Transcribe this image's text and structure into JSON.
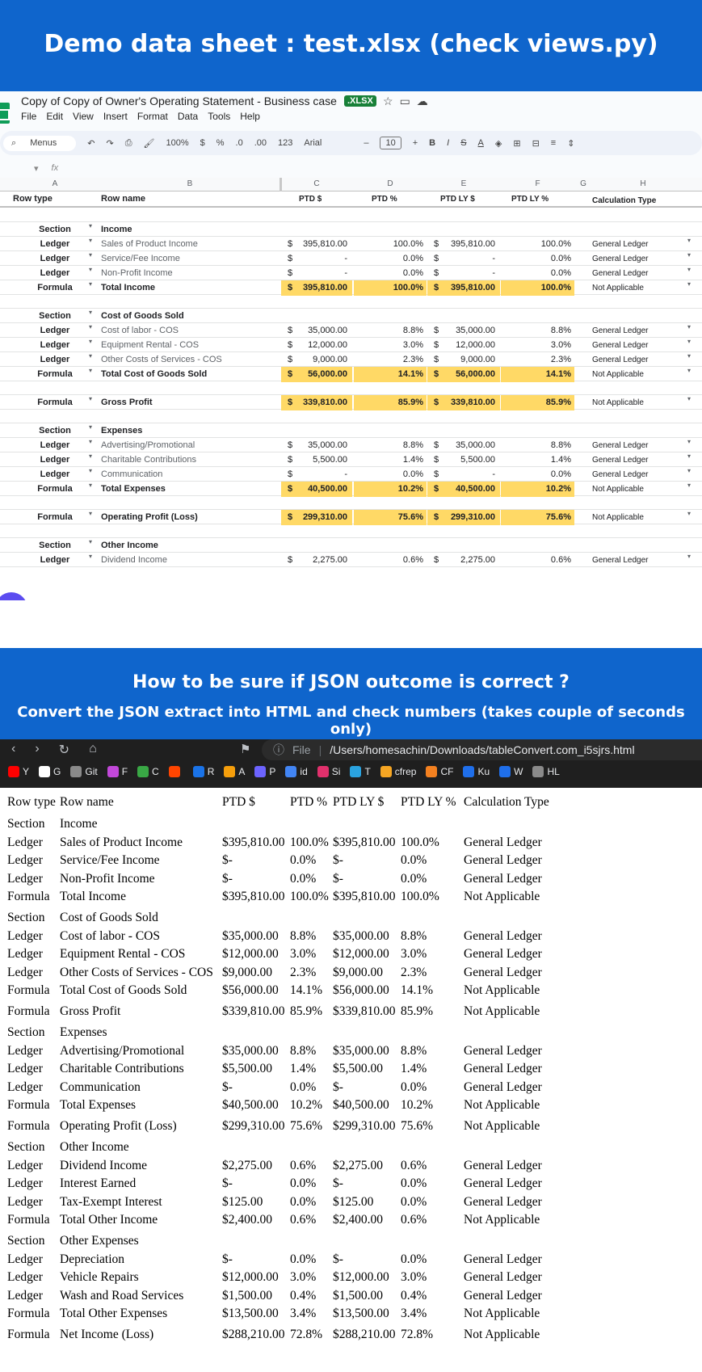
{
  "banner_top": "Demo data sheet :  test.xlsx (check views.py)",
  "banner_mid": {
    "title": "How to be sure if JSON outcome is correct ?",
    "subtitle": "Convert the JSON extract into HTML and check numbers (takes couple of seconds only)"
  },
  "sheets": {
    "doc_title": "Copy of Copy of Owner's Operating Statement - Business case",
    "badge": ".XLSX",
    "menu": [
      "File",
      "Edit",
      "View",
      "Insert",
      "Format",
      "Data",
      "Tools",
      "Help"
    ],
    "toolbar": {
      "menus": "Menus",
      "zoom": "100%",
      "currency": "$",
      "percent": "%",
      "dec_less": ".0",
      "dec_more": ".00",
      "fmt123": "123",
      "font": "Arial",
      "font_size": "10"
    },
    "fx": "fx",
    "col_letters": [
      "A",
      "B",
      "C",
      "D",
      "E",
      "F",
      "G",
      "H"
    ],
    "headers": {
      "row_type": "Row type",
      "row_name": "Row name",
      "ptd": "PTD $",
      "ptd_pct": "PTD %",
      "ptd_ly": "PTD LY $",
      "ptd_ly_pct": "PTD LY %",
      "calc": "Calculation Type"
    },
    "rows": [
      {
        "type": "",
        "name": "",
        "ptd": "",
        "ptd_pct": "",
        "ly": "",
        "ly_pct": "",
        "calc": "",
        "style": "blank"
      },
      {
        "type": "Section",
        "name": "Income",
        "ptd": "",
        "ptd_pct": "",
        "ly": "",
        "ly_pct": "",
        "calc": "",
        "style": "section"
      },
      {
        "type": "Ledger",
        "name": "Sales of Product Income",
        "ptd": "395,810.00",
        "ptd_pct": "100.0%",
        "ly": "395,810.00",
        "ly_pct": "100.0%",
        "calc": "General Ledger",
        "style": "ledger"
      },
      {
        "type": "Ledger",
        "name": "Service/Fee Income",
        "ptd": "-",
        "ptd_pct": "0.0%",
        "ly": "-",
        "ly_pct": "0.0%",
        "calc": "General Ledger",
        "style": "ledger"
      },
      {
        "type": "Ledger",
        "name": "Non-Profit Income",
        "ptd": "-",
        "ptd_pct": "0.0%",
        "ly": "-",
        "ly_pct": "0.0%",
        "calc": "General Ledger",
        "style": "ledger"
      },
      {
        "type": "Formula",
        "name": "Total Income",
        "ptd": "395,810.00",
        "ptd_pct": "100.0%",
        "ly": "395,810.00",
        "ly_pct": "100.0%",
        "calc": "Not Applicable",
        "style": "formula"
      },
      {
        "type": "",
        "name": "",
        "ptd": "",
        "ptd_pct": "",
        "ly": "",
        "ly_pct": "",
        "calc": "",
        "style": "blank"
      },
      {
        "type": "Section",
        "name": "Cost of Goods Sold",
        "ptd": "",
        "ptd_pct": "",
        "ly": "",
        "ly_pct": "",
        "calc": "",
        "style": "section"
      },
      {
        "type": "Ledger",
        "name": "Cost of labor - COS",
        "ptd": "35,000.00",
        "ptd_pct": "8.8%",
        "ly": "35,000.00",
        "ly_pct": "8.8%",
        "calc": "General Ledger",
        "style": "ledger"
      },
      {
        "type": "Ledger",
        "name": "Equipment Rental - COS",
        "ptd": "12,000.00",
        "ptd_pct": "3.0%",
        "ly": "12,000.00",
        "ly_pct": "3.0%",
        "calc": "General Ledger",
        "style": "ledger"
      },
      {
        "type": "Ledger",
        "name": "Other Costs of Services - COS",
        "ptd": "9,000.00",
        "ptd_pct": "2.3%",
        "ly": "9,000.00",
        "ly_pct": "2.3%",
        "calc": "General Ledger",
        "style": "ledger"
      },
      {
        "type": "Formula",
        "name": "Total Cost of Goods Sold",
        "ptd": "56,000.00",
        "ptd_pct": "14.1%",
        "ly": "56,000.00",
        "ly_pct": "14.1%",
        "calc": "Not Applicable",
        "style": "formula"
      },
      {
        "type": "",
        "name": "",
        "ptd": "",
        "ptd_pct": "",
        "ly": "",
        "ly_pct": "",
        "calc": "",
        "style": "blank"
      },
      {
        "type": "Formula",
        "name": "Gross Profit",
        "ptd": "339,810.00",
        "ptd_pct": "85.9%",
        "ly": "339,810.00",
        "ly_pct": "85.9%",
        "calc": "Not Applicable",
        "style": "formula"
      },
      {
        "type": "",
        "name": "",
        "ptd": "",
        "ptd_pct": "",
        "ly": "",
        "ly_pct": "",
        "calc": "",
        "style": "blank"
      },
      {
        "type": "Section",
        "name": "Expenses",
        "ptd": "",
        "ptd_pct": "",
        "ly": "",
        "ly_pct": "",
        "calc": "",
        "style": "section"
      },
      {
        "type": "Ledger",
        "name": "Advertising/Promotional",
        "ptd": "35,000.00",
        "ptd_pct": "8.8%",
        "ly": "35,000.00",
        "ly_pct": "8.8%",
        "calc": "General Ledger",
        "style": "ledger"
      },
      {
        "type": "Ledger",
        "name": "Charitable Contributions",
        "ptd": "5,500.00",
        "ptd_pct": "1.4%",
        "ly": "5,500.00",
        "ly_pct": "1.4%",
        "calc": "General Ledger",
        "style": "ledger"
      },
      {
        "type": "Ledger",
        "name": "Communication",
        "ptd": "-",
        "ptd_pct": "0.0%",
        "ly": "-",
        "ly_pct": "0.0%",
        "calc": "General Ledger",
        "style": "ledger"
      },
      {
        "type": "Formula",
        "name": "Total Expenses",
        "ptd": "40,500.00",
        "ptd_pct": "10.2%",
        "ly": "40,500.00",
        "ly_pct": "10.2%",
        "calc": "Not Applicable",
        "style": "formula"
      },
      {
        "type": "",
        "name": "",
        "ptd": "",
        "ptd_pct": "",
        "ly": "",
        "ly_pct": "",
        "calc": "",
        "style": "blank"
      },
      {
        "type": "Formula",
        "name": "Operating Profit (Loss)",
        "ptd": "299,310.00",
        "ptd_pct": "75.6%",
        "ly": "299,310.00",
        "ly_pct": "75.6%",
        "calc": "Not Applicable",
        "style": "formula"
      },
      {
        "type": "",
        "name": "",
        "ptd": "",
        "ptd_pct": "",
        "ly": "",
        "ly_pct": "",
        "calc": "",
        "style": "blank"
      },
      {
        "type": "Section",
        "name": "Other Income",
        "ptd": "",
        "ptd_pct": "",
        "ly": "",
        "ly_pct": "",
        "calc": "",
        "style": "section"
      },
      {
        "type": "Ledger",
        "name": "Dividend Income",
        "ptd": "2,275.00",
        "ptd_pct": "0.6%",
        "ly": "2,275.00",
        "ly_pct": "0.6%",
        "calc": "General Ledger",
        "style": "ledger"
      }
    ]
  },
  "browser": {
    "address_prefix": "File",
    "address": "/Users/homesachin/Downloads/tableConvert.com_i5sjrs.html",
    "bookmarks": [
      {
        "label": "Y",
        "color": "#ff0000"
      },
      {
        "label": "G",
        "color": "#ffffff"
      },
      {
        "label": "Git",
        "color": "#8a8a8a"
      },
      {
        "label": "F",
        "color": "#c248d9"
      },
      {
        "label": "C",
        "color": "#39a845"
      },
      {
        "label": "",
        "color": "#ff4500"
      },
      {
        "label": "R",
        "color": "#1a73e8"
      },
      {
        "label": "A",
        "color": "#f59e0b"
      },
      {
        "label": "P",
        "color": "#6c63ff"
      },
      {
        "label": "id",
        "color": "#4285f4"
      },
      {
        "label": "Si",
        "color": "#e1306c"
      },
      {
        "label": "T",
        "color": "#2aa3e0"
      },
      {
        "label": "cfrep",
        "color": "#f6a623"
      },
      {
        "label": "CF",
        "color": "#f48120"
      },
      {
        "label": "Ku",
        "color": "#1f6feb"
      },
      {
        "label": "W",
        "color": "#1f6feb"
      },
      {
        "label": "HL",
        "color": "#8a8a8a"
      }
    ]
  },
  "result_table": {
    "headers": [
      "Row type",
      "Row name",
      "PTD $",
      "PTD %",
      "PTD LY $",
      "PTD LY %",
      "Calculation Type"
    ],
    "rows": [
      [
        "Section",
        "Income",
        "",
        "",
        "",
        "",
        ""
      ],
      [
        "Ledger",
        "Sales of Product Income",
        "$395,810.00",
        "100.0%",
        "$395,810.00",
        "100.0%",
        "General Ledger"
      ],
      [
        "Ledger",
        "Service/Fee Income",
        "$-",
        "0.0%",
        "$-",
        "0.0%",
        "General Ledger"
      ],
      [
        "Ledger",
        "Non-Profit Income",
        "$-",
        "0.0%",
        "$-",
        "0.0%",
        "General Ledger"
      ],
      [
        "Formula",
        "Total Income",
        "$395,810.00",
        "100.0%",
        "$395,810.00",
        "100.0%",
        "Not Applicable"
      ],
      [
        "Section",
        "Cost of Goods Sold",
        "",
        "",
        "",
        "",
        ""
      ],
      [
        "Ledger",
        "Cost of labor - COS",
        "$35,000.00",
        "8.8%",
        "$35,000.00",
        "8.8%",
        "General Ledger"
      ],
      [
        "Ledger",
        "Equipment Rental - COS",
        "$12,000.00",
        "3.0%",
        "$12,000.00",
        "3.0%",
        "General Ledger"
      ],
      [
        "Ledger",
        "Other Costs of Services - COS",
        "$9,000.00",
        "2.3%",
        "$9,000.00",
        "2.3%",
        "General Ledger"
      ],
      [
        "Formula",
        "Total Cost of Goods Sold",
        "$56,000.00",
        "14.1%",
        "$56,000.00",
        "14.1%",
        "Not Applicable"
      ],
      [
        "Formula",
        "Gross Profit",
        "$339,810.00",
        "85.9%",
        "$339,810.00",
        "85.9%",
        "Not Applicable"
      ],
      [
        "Section",
        "Expenses",
        "",
        "",
        "",
        "",
        ""
      ],
      [
        "Ledger",
        "Advertising/Promotional",
        "$35,000.00",
        "8.8%",
        "$35,000.00",
        "8.8%",
        "General Ledger"
      ],
      [
        "Ledger",
        "Charitable Contributions",
        "$5,500.00",
        "1.4%",
        "$5,500.00",
        "1.4%",
        "General Ledger"
      ],
      [
        "Ledger",
        "Communication",
        "$-",
        "0.0%",
        "$-",
        "0.0%",
        "General Ledger"
      ],
      [
        "Formula",
        "Total Expenses",
        "$40,500.00",
        "10.2%",
        "$40,500.00",
        "10.2%",
        "Not Applicable"
      ],
      [
        "Formula",
        "Operating Profit (Loss)",
        "$299,310.00",
        "75.6%",
        "$299,310.00",
        "75.6%",
        "Not Applicable"
      ],
      [
        "Section",
        "Other Income",
        "",
        "",
        "",
        "",
        ""
      ],
      [
        "Ledger",
        "Dividend Income",
        "$2,275.00",
        "0.6%",
        "$2,275.00",
        "0.6%",
        "General Ledger"
      ],
      [
        "Ledger",
        "Interest Earned",
        "$-",
        "0.0%",
        "$-",
        "0.0%",
        "General Ledger"
      ],
      [
        "Ledger",
        "Tax-Exempt Interest",
        "$125.00",
        "0.0%",
        "$125.00",
        "0.0%",
        "General Ledger"
      ],
      [
        "Formula",
        "Total Other Income",
        "$2,400.00",
        "0.6%",
        "$2,400.00",
        "0.6%",
        "Not Applicable"
      ],
      [
        "Section",
        "Other Expenses",
        "",
        "",
        "",
        "",
        ""
      ],
      [
        "Ledger",
        "Depreciation",
        "$-",
        "0.0%",
        "$-",
        "0.0%",
        "General Ledger"
      ],
      [
        "Ledger",
        "Vehicle Repairs",
        "$12,000.00",
        "3.0%",
        "$12,000.00",
        "3.0%",
        "General Ledger"
      ],
      [
        "Ledger",
        "Wash and Road Services",
        "$1,500.00",
        "0.4%",
        "$1,500.00",
        "0.4%",
        "General Ledger"
      ],
      [
        "Formula",
        "Total Other Expenses",
        "$13,500.00",
        "3.4%",
        "$13,500.00",
        "3.4%",
        "Not Applicable"
      ],
      [
        "Formula",
        "Net Income (Loss)",
        "$288,210.00",
        "72.8%",
        "$288,210.00",
        "72.8%",
        "Not Applicable"
      ]
    ]
  }
}
